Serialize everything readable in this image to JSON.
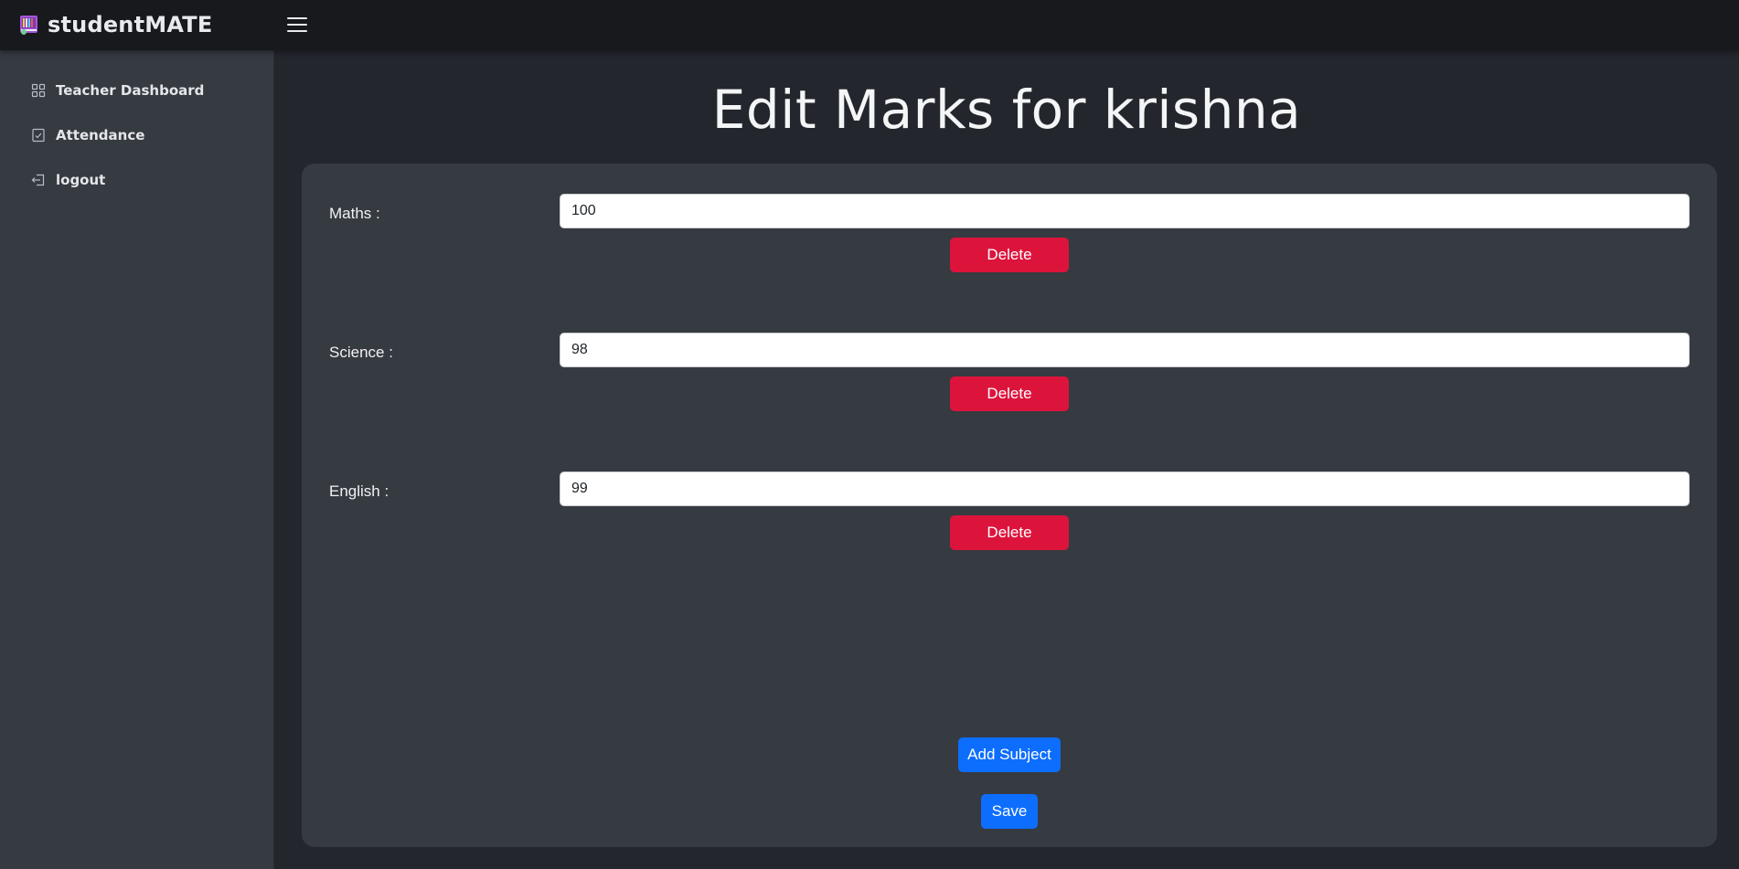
{
  "brand": {
    "name": "studentMATE",
    "icon": "book-logo-icon"
  },
  "header": {
    "menu_icon": "hamburger-menu-icon"
  },
  "sidebar": {
    "items": [
      {
        "label": "Teacher Dashboard",
        "icon": "grid-icon"
      },
      {
        "label": "Attendance",
        "icon": "checklist-icon"
      },
      {
        "label": "logout",
        "icon": "logout-icon"
      }
    ]
  },
  "page": {
    "title": "Edit Marks for krishna"
  },
  "subjects": [
    {
      "label": "Maths :",
      "value": "100",
      "delete_label": "Delete"
    },
    {
      "label": "Science :",
      "value": "98",
      "delete_label": "Delete"
    },
    {
      "label": "English :",
      "value": "99",
      "delete_label": "Delete"
    }
  ],
  "actions": {
    "add_label": "Add Subject",
    "save_label": "Save"
  },
  "colors": {
    "topbar": "#17191c",
    "sidebar": "#363a41",
    "background": "#23272d",
    "card": "#363a41",
    "delete": "#dc143c",
    "primary": "#0d6efd"
  }
}
